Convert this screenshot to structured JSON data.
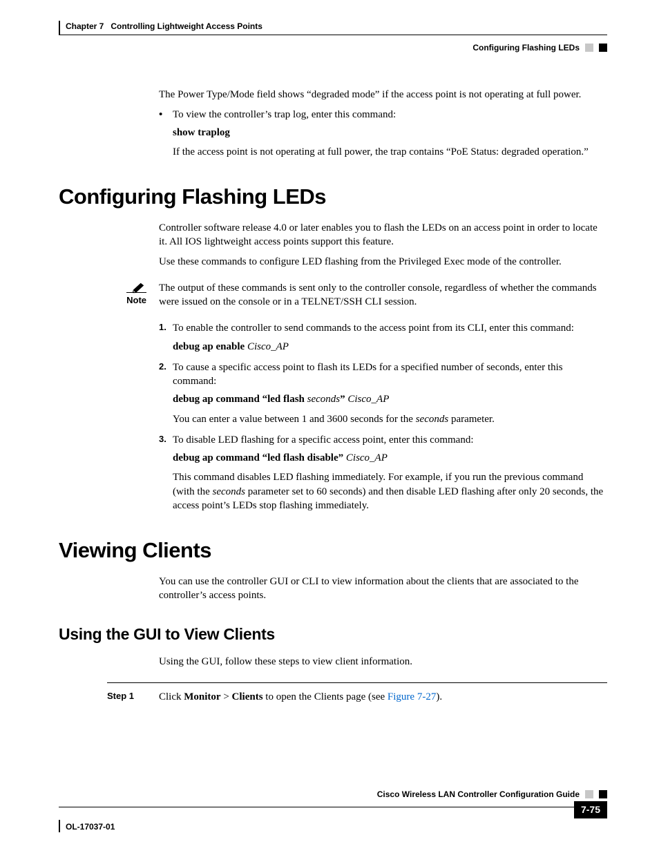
{
  "header": {
    "chapter_label": "Chapter 7",
    "chapter_title": "Controlling Lightweight Access Points",
    "section_right": "Configuring Flashing LEDs"
  },
  "intro": {
    "power_mode": "The Power Type/Mode field shows “degraded mode” if the access point is not operating at full power.",
    "bullet_trap": "To view the controller’s trap log, enter this command:",
    "cmd_show": "show traplog",
    "trap_follow": "If the access point is not operating at full power, the trap contains “PoE Status: degraded operation.”"
  },
  "sec1": {
    "title": "Configuring Flashing LEDs",
    "p1": "Controller software release 4.0 or later enables you to flash the LEDs on an access point in order to locate it. All IOS lightweight access points support this feature.",
    "p2": "Use these commands to configure LED flashing from the Privileged Exec mode of the controller.",
    "note_label": "Note",
    "note_body": "The output of these commands is sent only to the controller console, regardless of whether the commands were issued on the console or in a TELNET/SSH CLI session.",
    "s1": {
      "num": "1.",
      "text": "To enable the controller to send commands to the access point from its CLI, enter this command:",
      "cmd_bold": "debug ap enable ",
      "cmd_ital": "Cisco_AP"
    },
    "s2": {
      "num": "2.",
      "text": "To cause a specific access point to flash its LEDs for a specified number of seconds, enter this command:",
      "cmd_b1": "debug ap command “led flash ",
      "cmd_i1": "seconds",
      "cmd_b2": "” ",
      "cmd_i2": "Cisco_AP",
      "follow_a": "You can enter a value between 1 and 3600 seconds for the ",
      "follow_i": "seconds",
      "follow_b": " parameter."
    },
    "s3": {
      "num": "3.",
      "text": "To disable LED flashing for a specific access point, enter this command:",
      "cmd_b1": "debug ap command “led flash disable” ",
      "cmd_i1": "Cisco_AP",
      "follow_a": "This command disables LED flashing immediately. For example, if you run the previous command (with the ",
      "follow_i": "seconds",
      "follow_b": " parameter set to 60 seconds) and then disable LED flashing after only 20 seconds, the access point’s LEDs stop flashing immediately."
    }
  },
  "sec2": {
    "title": "Viewing Clients",
    "p1": "You can use the controller GUI or CLI to view information about the clients that are associated to the controller’s access points.",
    "sub_title": "Using the GUI to View Clients",
    "sub_p": "Using the GUI, follow these steps to view client information.",
    "step_label": "Step 1",
    "step_a": "Click ",
    "step_b1": "Monitor",
    "step_mid": " > ",
    "step_b2": "Clients",
    "step_c": " to open the Clients page (see ",
    "step_link": "Figure 7-27",
    "step_end": ")."
  },
  "footer": {
    "guide": "Cisco Wireless LAN Controller Configuration Guide",
    "doc": "OL-17037-01",
    "page": "7-75"
  }
}
